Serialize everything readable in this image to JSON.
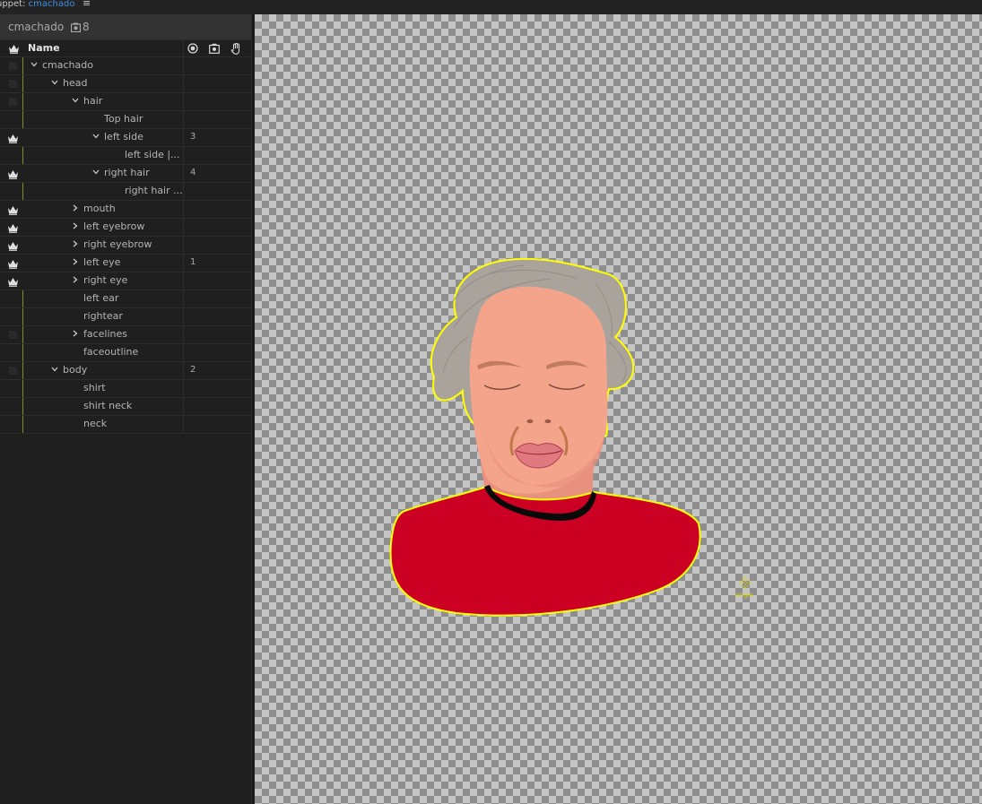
{
  "topbar": {
    "label": "uppet:",
    "puppet_name": "cmachado",
    "menu_glyph": "≡"
  },
  "panel": {
    "title": "cmachado",
    "count": "8",
    "column_name": "Name",
    "rows": [
      {
        "label": "cmachado",
        "indent": 0,
        "expander": "down",
        "crown": false,
        "number": ""
      },
      {
        "label": "head",
        "indent": 1,
        "expander": "down",
        "crown": false,
        "number": ""
      },
      {
        "label": "hair",
        "indent": 2,
        "expander": "down",
        "crown": false,
        "number": ""
      },
      {
        "label": "Top hair",
        "indent": 3,
        "expander": "none",
        "crown": false,
        "number": ""
      },
      {
        "label": "left side",
        "indent": 3,
        "expander": "down",
        "crown": true,
        "number": "3"
      },
      {
        "label": "left side |...",
        "indent": 4,
        "expander": "none",
        "crown": false,
        "number": ""
      },
      {
        "label": "right hair",
        "indent": 3,
        "expander": "down",
        "crown": true,
        "number": "4"
      },
      {
        "label": "right hair ...",
        "indent": 4,
        "expander": "none",
        "crown": false,
        "number": ""
      },
      {
        "label": "mouth",
        "indent": 2,
        "expander": "right",
        "crown": true,
        "number": ""
      },
      {
        "label": "left eyebrow",
        "indent": 2,
        "expander": "right",
        "crown": true,
        "number": ""
      },
      {
        "label": "right eyebrow",
        "indent": 2,
        "expander": "right",
        "crown": true,
        "number": ""
      },
      {
        "label": "left eye",
        "indent": 2,
        "expander": "right",
        "crown": true,
        "number": "1"
      },
      {
        "label": "right eye",
        "indent": 2,
        "expander": "right",
        "crown": true,
        "number": ""
      },
      {
        "label": "left ear",
        "indent": 2,
        "expander": "none",
        "crown": false,
        "number": ""
      },
      {
        "label": "rightear",
        "indent": 2,
        "expander": "none",
        "crown": false,
        "number": ""
      },
      {
        "label": "facelines",
        "indent": 2,
        "expander": "right",
        "crown": false,
        "number": ""
      },
      {
        "label": "faceoutline",
        "indent": 2,
        "expander": "none",
        "crown": false,
        "number": ""
      },
      {
        "label": "body",
        "indent": 1,
        "expander": "down",
        "crown": false,
        "number": "2"
      },
      {
        "label": "shirt",
        "indent": 2,
        "expander": "none",
        "crown": false,
        "number": ""
      },
      {
        "label": "shirt neck",
        "indent": 2,
        "expander": "none",
        "crown": false,
        "number": ""
      },
      {
        "label": "neck",
        "indent": 2,
        "expander": "none",
        "crown": false,
        "number": ""
      }
    ]
  },
  "canvas": {
    "origin_label": "origin"
  },
  "colors": {
    "accent_blue": "#3d8ee6",
    "selection_yellow": "#ffff00",
    "shirt_red": "#cc0022",
    "skin": "#f5a48c",
    "hair_gray": "#a9a39b"
  }
}
